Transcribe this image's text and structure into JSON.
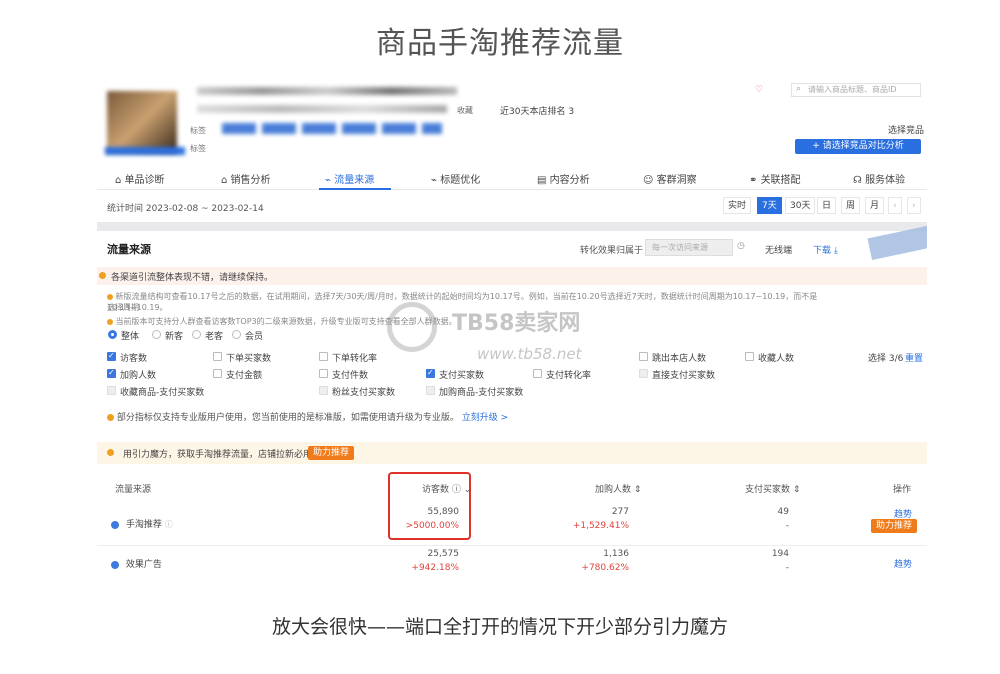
{
  "page_title": "商品手淘推荐流量",
  "caption": "放大会很快——端口全打开的情况下开少部分引力魔方",
  "header": {
    "favorite_label": "收藏",
    "search_placeholder": "请输入商品标题、商品ID",
    "rank_label": "近30天本店排名 3",
    "choose_product": "选择竞品",
    "compare_button": "+ 请选择竞品对比分析",
    "tag_row_label": "标签",
    "tag2_label": "标签"
  },
  "tabs": [
    "单品诊断",
    "销售分析",
    "流量来源",
    "标题优化",
    "内容分析",
    "客群洞察",
    "关联搭配",
    "服务体验"
  ],
  "date": {
    "range": "统计时间 2023-02-08 ~ 2023-02-14",
    "periods": [
      "实时",
      "7天",
      "30天",
      "日",
      "周",
      "月"
    ]
  },
  "section": {
    "title": "流量来源",
    "conversion_label": "转化效果归属于",
    "select_placeholder": "每一次访问来源",
    "device": "无线端",
    "download": "下载"
  },
  "notices": {
    "good": "各渠道引流整体表现不错，请继续保持。",
    "line1": "新版流量结构可查看10.17号之后的数据，在试用期间，选择7天/30天/周/月时，数据统计的起始时间均为10.17号。例如，当前在10.20号选择近7天时，数据统计时间周期为10.17~10.19，而不是10.13~10.19。",
    "line1b": "选择周期",
    "line2": "当前版本可支持分人群查看访客数TOP3的二级来源数据，升级专业版可支持查看全部人群数据。"
  },
  "audience": [
    "整体",
    "新客",
    "老客",
    "会员"
  ],
  "metrics": [
    {
      "label": "访客数",
      "checked": true
    },
    {
      "label": "下单买家数",
      "checked": false
    },
    {
      "label": "下单转化率",
      "checked": false
    },
    {
      "label": "跳出本店人数",
      "checked": false
    },
    {
      "label": "收藏人数",
      "checked": false
    },
    {
      "label": "加购人数",
      "checked": true
    },
    {
      "label": "支付金额",
      "checked": false
    },
    {
      "label": "支付件数",
      "checked": false
    },
    {
      "label": "支付买家数",
      "checked": true
    },
    {
      "label": "支付转化率",
      "checked": false
    },
    {
      "label": "直接支付买家数",
      "checked": false
    },
    {
      "label": "收藏商品-支付买家数",
      "checked": false
    },
    {
      "label": "粉丝支付买家数",
      "checked": false
    },
    {
      "label": "加购商品-支付买家数",
      "checked": false
    }
  ],
  "select_count": "选择 3/6",
  "reset": "重置",
  "pro_notice": "部分指标仅支持专业版用户使用，您当前使用的是标准版，如需使用请升级为专业版。",
  "upgrade_link": "立刻升级 >",
  "upsell": {
    "text": "用引力魔方，获取手淘推荐流量，店铺拉新必用。",
    "button": "助力推荐"
  },
  "table": {
    "headers": [
      "流量来源",
      "访客数",
      "加购人数",
      "支付买家数",
      "操作"
    ],
    "rows": [
      {
        "source": "手淘推荐",
        "visitors": "55,890",
        "visitors_change": ">5000.00%",
        "cart": "277",
        "cart_change": "+1,529.41%",
        "buyers": "49",
        "buyers_change": "-",
        "action": "趋势",
        "action2": "助力推荐"
      },
      {
        "source": "效果广告",
        "visitors": "25,575",
        "visitors_change": "+942.18%",
        "cart": "1,136",
        "cart_change": "+780.62%",
        "buyers": "194",
        "buyers_change": "-",
        "action": "趋势",
        "action2": ""
      }
    ]
  },
  "watermark": {
    "brand": "TB58卖家网",
    "url": "www.tb58.net"
  },
  "colors": {
    "accent": "#2a6fe0",
    "highlight": "#e0302a",
    "orange": "#f07b1a"
  }
}
